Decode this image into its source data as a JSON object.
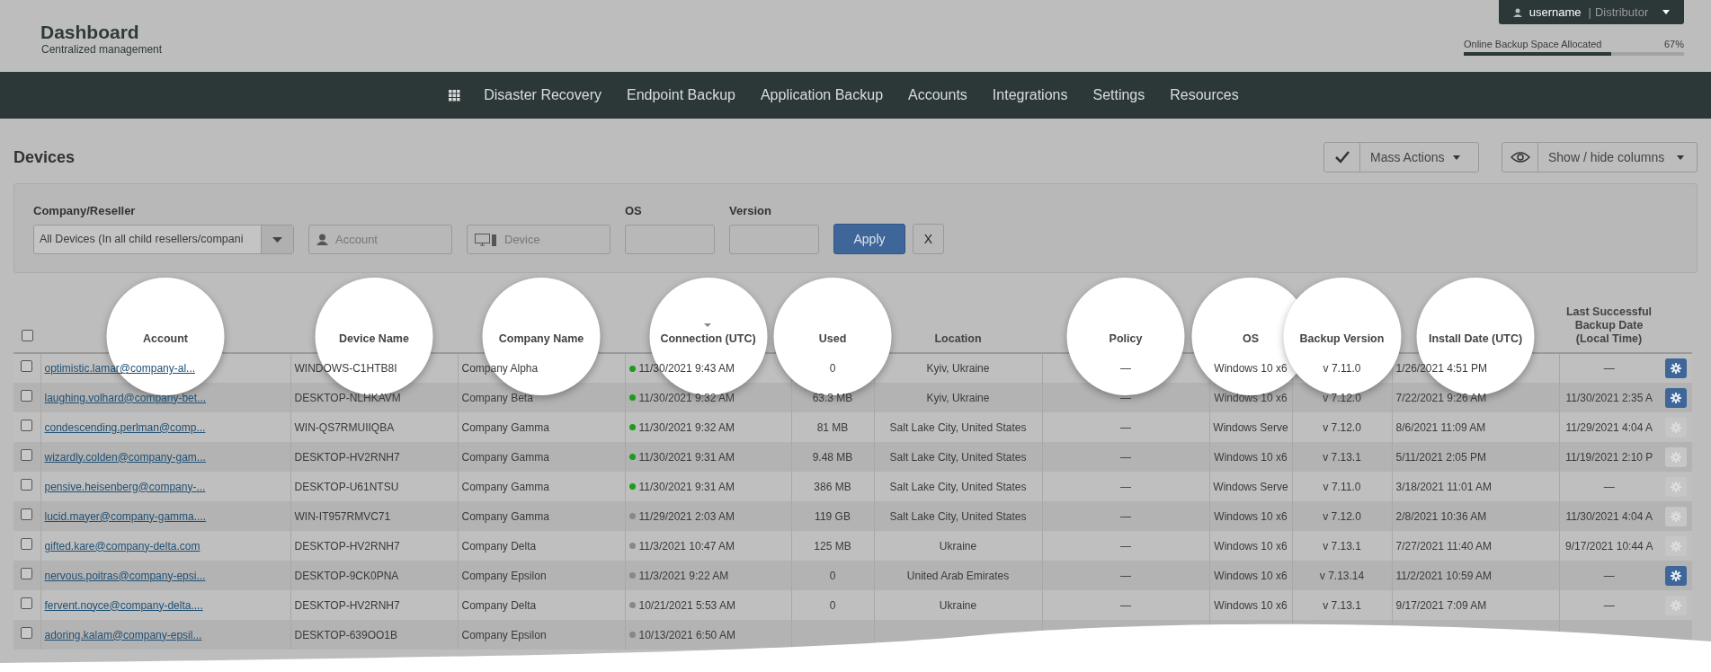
{
  "header": {
    "title": "Dashboard",
    "subtitle": "Centralized management"
  },
  "user_menu": {
    "username": "username",
    "separator": "|",
    "role": "Distributor"
  },
  "storage": {
    "label": "Online Backup Space Allocated",
    "reading": "67%",
    "level": 0.67
  },
  "nav": {
    "items": [
      "Disaster Recovery",
      "Endpoint Backup",
      "Application Backup",
      "Accounts",
      "Integrations",
      "Settings",
      "Resources"
    ]
  },
  "page_title": "Devices",
  "toolbar": {
    "mass_actions": "Mass Actions",
    "columns_button": "Show / hide columns"
  },
  "filters": {
    "company_label": "Company/Reseller",
    "company_value": "All Devices (In all child resellers/compani",
    "account_placeholder": "Account",
    "device_placeholder": "Device",
    "os_label": "OS",
    "version_label": "Version",
    "apply": "Apply",
    "clear": "X"
  },
  "table": {
    "header_checkbox": {
      "checked": false
    },
    "columns": [
      {
        "label": "Account",
        "sorted": false,
        "highlighted": true
      },
      {
        "label": "Device Name",
        "sorted": false,
        "highlighted": true
      },
      {
        "label": "Company Name",
        "sorted": false,
        "highlighted": true
      },
      {
        "label": "Connection (UTC)",
        "sorted": true,
        "highlighted": true
      },
      {
        "label": "Used",
        "sorted": false,
        "highlighted": true
      },
      {
        "label": "Location",
        "sorted": false,
        "highlighted": false
      },
      {
        "label": "Policy",
        "sorted": false,
        "highlighted": true
      },
      {
        "label": "OS",
        "sorted": false,
        "highlighted": true
      },
      {
        "label": "Backup Version",
        "sorted": false,
        "highlighted": true
      },
      {
        "label": "Install Date (UTC)",
        "sorted": false,
        "highlighted": true
      },
      {
        "label": "Last Successful Backup Date (Local Time)",
        "sorted": false,
        "highlighted": false
      }
    ],
    "rows": [
      {
        "checked": false,
        "account": "optimistic.lamar@company-al...",
        "device": "WINDOWS-C1HTB8I",
        "company": "Company Alpha",
        "online": true,
        "connection": "11/30/2021 9:43 AM",
        "used": "0",
        "location": "Kyiv, Ukraine",
        "policy": "—",
        "os": "Windows 10 x6",
        "version": "v 7.11.0",
        "install": "1/26/2021 4:51 PM",
        "last_backup": "—",
        "settings_enabled": true
      },
      {
        "checked": false,
        "account": "laughing.volhard@company-bet...",
        "device": "DESKTOP-NLHKAVM",
        "company": "Company Beta",
        "online": true,
        "connection": "11/30/2021 9:32 AM",
        "used": "63.3 MB",
        "location": "Kyiv, Ukraine",
        "policy": "—",
        "os": "Windows 10 x6",
        "version": "v 7.12.0",
        "install": "7/22/2021 9:26 AM",
        "last_backup": "11/30/2021 2:35 A",
        "settings_enabled": true
      },
      {
        "checked": false,
        "account": "condescending.perlman@comp...",
        "device": "WIN-QS7RMUIIQBA",
        "company": "Company Gamma",
        "online": true,
        "connection": "11/30/2021 9:32 AM",
        "used": "81 MB",
        "location": "Salt Lake City, United States",
        "policy": "—",
        "os": "Windows Serve",
        "version": "v 7.12.0",
        "install": "8/6/2021 11:09 AM",
        "last_backup": "11/29/2021 4:04 A",
        "settings_enabled": false
      },
      {
        "checked": false,
        "account": "wizardly.colden@company-gam...",
        "device": "DESKTOP-HV2RNH7",
        "company": "Company Gamma",
        "online": true,
        "connection": "11/30/2021 9:31 AM",
        "used": "9.48 MB",
        "location": "Salt Lake City, United States",
        "policy": "—",
        "os": "Windows 10 x6",
        "version": "v 7.13.1",
        "install": "5/11/2021 2:05 PM",
        "last_backup": "11/19/2021 2:10 P",
        "settings_enabled": false
      },
      {
        "checked": false,
        "account": "pensive.heisenberg@company-...",
        "device": "DESKTOP-U61NTSU",
        "company": "Company Gamma",
        "online": true,
        "connection": "11/30/2021 9:31 AM",
        "used": "386 MB",
        "location": "Salt Lake City, United States",
        "policy": "—",
        "os": "Windows Serve",
        "version": "v 7.11.0",
        "install": "3/18/2021 11:01 AM",
        "last_backup": "—",
        "settings_enabled": false
      },
      {
        "checked": false,
        "account": "lucid.mayer@company-gamma....",
        "device": "WIN-IT957RMVC71",
        "company": "Company Gamma",
        "online": false,
        "connection": "11/29/2021 2:03 AM",
        "used": "119 GB",
        "location": "Salt Lake City, United States",
        "policy": "—",
        "os": "Windows 10 x6",
        "version": "v 7.12.0",
        "install": "2/8/2021 10:36 AM",
        "last_backup": "11/30/2021 4:04 A",
        "settings_enabled": false
      },
      {
        "checked": false,
        "account": "gifted.kare@company-delta.com",
        "device": "DESKTOP-HV2RNH7",
        "company": "Company Delta",
        "online": false,
        "connection": "11/3/2021 10:47 AM",
        "used": "125 MB",
        "location": "Ukraine",
        "policy": "—",
        "os": "Windows 10 x6",
        "version": "v 7.13.1",
        "install": "7/27/2021 11:40 AM",
        "last_backup": "9/17/2021 10:44 A",
        "settings_enabled": false
      },
      {
        "checked": false,
        "account": "nervous.poitras@company-epsi...",
        "device": "DESKTOP-9CK0PNA",
        "company": "Company Epsilon",
        "online": false,
        "connection": "11/3/2021 9:22 AM",
        "used": "0",
        "location": "United Arab Emirates",
        "policy": "—",
        "os": "Windows 10 x6",
        "version": "v 7.13.14",
        "install": "11/2/2021 10:59 AM",
        "last_backup": "—",
        "settings_enabled": true
      },
      {
        "checked": false,
        "account": "fervent.noyce@company-delta....",
        "device": "DESKTOP-HV2RNH7",
        "company": "Company Delta",
        "online": false,
        "connection": "10/21/2021 5:53 AM",
        "used": "0",
        "location": "Ukraine",
        "policy": "—",
        "os": "Windows 10 x6",
        "version": "v 7.13.1",
        "install": "9/17/2021 7:09 AM",
        "last_backup": "—",
        "settings_enabled": false
      },
      {
        "checked": false,
        "account": "adoring.kalam@company-epsil...",
        "device": "DESKTOP-639OO1B",
        "company": "Company Epsilon",
        "online": false,
        "connection": "10/13/2021 6:50 AM"
      }
    ]
  }
}
